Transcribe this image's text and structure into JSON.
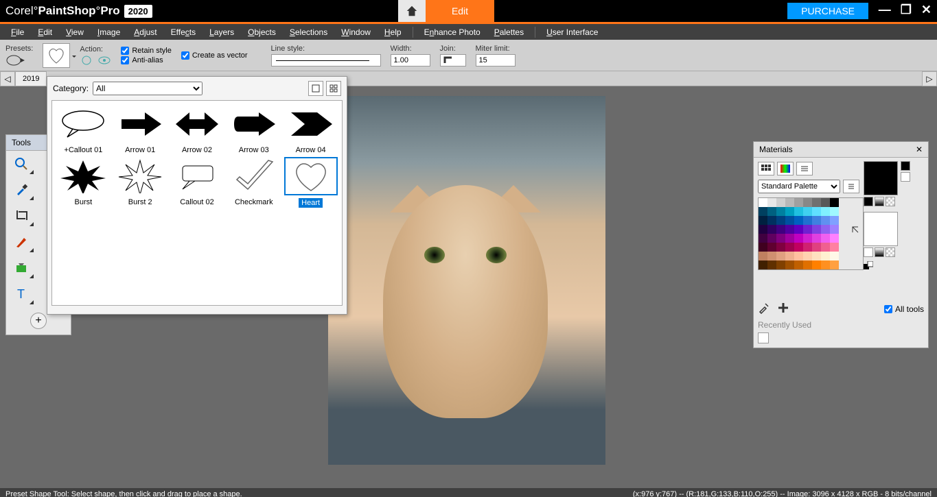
{
  "title": {
    "brand": "Corel",
    "product1": "PaintShop",
    "product2": "Pro",
    "year": "2020"
  },
  "header": {
    "edit_label": "Edit",
    "purchase_label": "PURCHASE"
  },
  "menu": [
    "File",
    "Edit",
    "View",
    "Image",
    "Adjust",
    "Effects",
    "Layers",
    "Objects",
    "Selections",
    "Window",
    "Help",
    "Enhance Photo",
    "Palettes",
    "User Interface"
  ],
  "tooloptions": {
    "presets_label": "Presets:",
    "action_label": "Action:",
    "retain_style": "Retain style",
    "anti_alias": "Anti-alias",
    "create_vector": "Create as vector",
    "line_style_label": "Line style:",
    "width_label": "Width:",
    "width_value": "1.00",
    "join_label": "Join:",
    "miter_label": "Miter limit:",
    "miter_value": "15"
  },
  "tabs": {
    "tab1": "2019"
  },
  "tools_panel": {
    "title": "Tools"
  },
  "shape_picker": {
    "category_label": "Category:",
    "category_value": "All",
    "shapes": [
      "+Callout 01",
      "Arrow 01",
      "Arrow 02",
      "Arrow 03",
      "Arrow 04",
      "Burst",
      "Burst 2",
      "Callout 02",
      "Checkmark",
      "Heart"
    ],
    "selected": "Heart"
  },
  "materials": {
    "title": "Materials",
    "palette_label": "Standard Palette",
    "all_tools": "All tools",
    "recently_used": "Recently Used"
  },
  "swatch_colors": [
    "#ffffff",
    "#e8e8e8",
    "#d0d0d0",
    "#b8b8b8",
    "#a0a0a0",
    "#888888",
    "#707070",
    "#585858",
    "#000000",
    "#004060",
    "#006080",
    "#0080a0",
    "#00a0c0",
    "#20c0e0",
    "#40d0f0",
    "#60e0ff",
    "#80f0ff",
    "#a0f8ff",
    "#002040",
    "#003060",
    "#004080",
    "#0050a0",
    "#0060c0",
    "#2070d0",
    "#4080e0",
    "#6090f0",
    "#80a0ff",
    "#200040",
    "#300060",
    "#400080",
    "#5000a0",
    "#6000c0",
    "#7020d0",
    "#8040e0",
    "#9060f0",
    "#a080ff",
    "#400040",
    "#600060",
    "#800080",
    "#a000a0",
    "#c000c0",
    "#d020d0",
    "#e040e0",
    "#f060f0",
    "#ff80ff",
    "#400020",
    "#600030",
    "#800040",
    "#a00050",
    "#c00060",
    "#d02070",
    "#e04080",
    "#f06090",
    "#ff80a0",
    "#c08060",
    "#d09070",
    "#e0a080",
    "#f0b090",
    "#ffc0a0",
    "#ffd0b0",
    "#ffe0c0",
    "#fff0d0",
    "#fff8e8",
    "#402000",
    "#603000",
    "#804000",
    "#a05000",
    "#c06000",
    "#e07000",
    "#ff8000",
    "#ff9020",
    "#ffa040"
  ],
  "statusbar": {
    "left": "Preset Shape Tool: Select shape, then click and drag to place a shape.",
    "right": "(x:976 y:767) -- (R:181,G:133,B:110,O:255) -- Image:  3096 x 4128 x RGB - 8 bits/channel"
  }
}
